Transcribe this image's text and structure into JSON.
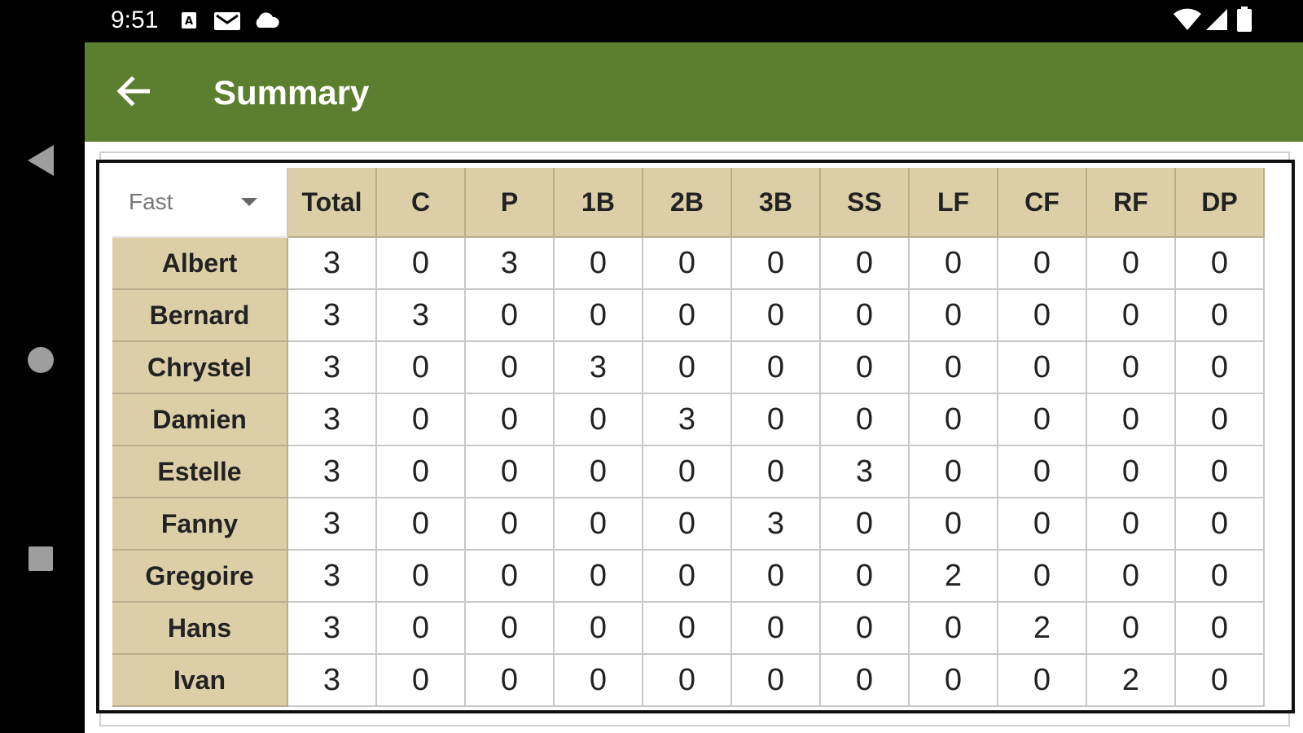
{
  "status_bar": {
    "time": "9:51",
    "icons": [
      "a-badge-icon",
      "gmail-icon",
      "cloud-icon",
      "wifi-icon",
      "signal-icon",
      "battery-icon"
    ]
  },
  "nav": {
    "icons": [
      "back-triangle-icon",
      "home-circle-icon",
      "recents-square-icon"
    ]
  },
  "toolbar": {
    "title": "Summary",
    "back_icon": "arrow-left-icon",
    "color": "#5b7f2e"
  },
  "table": {
    "filter": {
      "selected": "Fast"
    },
    "columns": [
      "Total",
      "C",
      "P",
      "1B",
      "2B",
      "3B",
      "SS",
      "LF",
      "CF",
      "RF",
      "DP"
    ],
    "header_color": "#dccfa8",
    "rows": [
      {
        "name": "Albert",
        "values": [
          "3",
          "0",
          "3",
          "0",
          "0",
          "0",
          "0",
          "0",
          "0",
          "0",
          "0"
        ]
      },
      {
        "name": "Bernard",
        "values": [
          "3",
          "3",
          "0",
          "0",
          "0",
          "0",
          "0",
          "0",
          "0",
          "0",
          "0"
        ]
      },
      {
        "name": "Chrystel",
        "values": [
          "3",
          "0",
          "0",
          "3",
          "0",
          "0",
          "0",
          "0",
          "0",
          "0",
          "0"
        ]
      },
      {
        "name": "Damien",
        "values": [
          "3",
          "0",
          "0",
          "0",
          "3",
          "0",
          "0",
          "0",
          "0",
          "0",
          "0"
        ]
      },
      {
        "name": "Estelle",
        "values": [
          "3",
          "0",
          "0",
          "0",
          "0",
          "0",
          "3",
          "0",
          "0",
          "0",
          "0"
        ]
      },
      {
        "name": "Fanny",
        "values": [
          "3",
          "0",
          "0",
          "0",
          "0",
          "3",
          "0",
          "0",
          "0",
          "0",
          "0"
        ]
      },
      {
        "name": "Gregoire",
        "values": [
          "3",
          "0",
          "0",
          "0",
          "0",
          "0",
          "0",
          "2",
          "0",
          "0",
          "0"
        ]
      },
      {
        "name": "Hans",
        "values": [
          "3",
          "0",
          "0",
          "0",
          "0",
          "0",
          "0",
          "0",
          "2",
          "0",
          "0"
        ]
      },
      {
        "name": "Ivan",
        "values": [
          "3",
          "0",
          "0",
          "0",
          "0",
          "0",
          "0",
          "0",
          "0",
          "2",
          "0"
        ]
      }
    ]
  }
}
